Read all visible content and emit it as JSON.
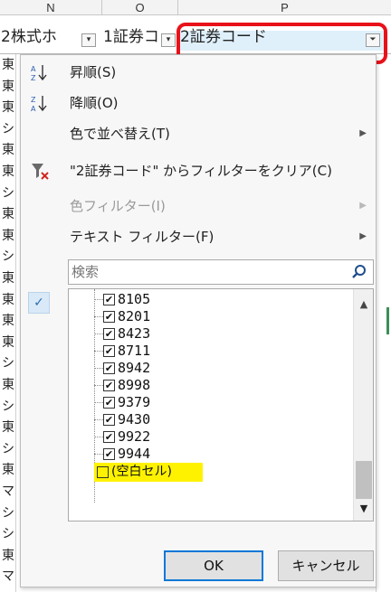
{
  "sheet": {
    "column_headers": [
      "N",
      "O",
      "P"
    ],
    "filter_cells": [
      {
        "label": "2株式ホ",
        "has_dropdown": true
      },
      {
        "label": "1証券コ",
        "has_dropdown": true
      },
      {
        "label": "2証券コード",
        "has_dropdown": true,
        "highlighted": true
      }
    ],
    "left_column_chars": [
      "東",
      "東",
      "東",
      "シ",
      "東",
      "東",
      "シ",
      "東",
      "東",
      "シ",
      "東",
      "東",
      "東",
      "東",
      "シ",
      "東",
      "シ",
      "東",
      "シ",
      "東",
      "マ",
      "シ",
      "シ",
      "東",
      "マ"
    ],
    "highlight_color": "#e8111a"
  },
  "menu": {
    "items": [
      {
        "label": "昇順(S)",
        "icon": "sort-ascending-icon",
        "icon_glyph": "A↓",
        "enabled": true,
        "has_submenu": false
      },
      {
        "label": "降順(O)",
        "icon": "sort-descending-icon",
        "icon_glyph": "Z↓",
        "enabled": true,
        "has_submenu": false
      },
      {
        "label": "色で並べ替え(T)",
        "icon": "",
        "icon_glyph": "",
        "enabled": true,
        "has_submenu": true
      },
      {
        "label": "\"2証券コード\" からフィルターをクリア(C)",
        "icon": "clear-filter-icon",
        "icon_glyph": "⨯",
        "enabled": true,
        "has_submenu": false
      },
      {
        "label": "色フィルター(I)",
        "icon": "",
        "icon_glyph": "",
        "enabled": false,
        "has_submenu": true
      },
      {
        "label": "テキスト フィルター(F)",
        "icon": "",
        "icon_glyph": "",
        "enabled": true,
        "has_submenu": true
      }
    ],
    "search": {
      "placeholder": "検索",
      "icon": "search-icon"
    },
    "list_items": [
      {
        "label": "8105",
        "checked": true
      },
      {
        "label": "8201",
        "checked": true
      },
      {
        "label": "8423",
        "checked": true
      },
      {
        "label": "8711",
        "checked": true
      },
      {
        "label": "8942",
        "checked": true
      },
      {
        "label": "8998",
        "checked": true
      },
      {
        "label": "9379",
        "checked": true
      },
      {
        "label": "9430",
        "checked": true
      },
      {
        "label": "9922",
        "checked": true
      },
      {
        "label": "9944",
        "checked": true
      },
      {
        "label": "(空白セル)",
        "checked": false,
        "highlight": "#fff200"
      }
    ],
    "side_check": "✓",
    "ok_label": "OK",
    "cancel_label": "キャンセル"
  }
}
